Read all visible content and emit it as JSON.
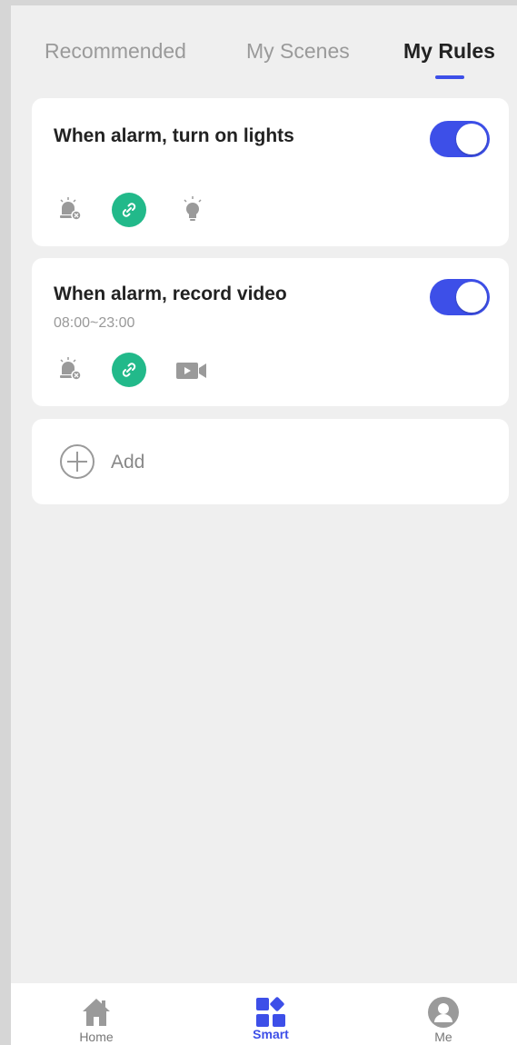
{
  "tabs": {
    "items": [
      {
        "label": "Recommended"
      },
      {
        "label": "My Scenes"
      },
      {
        "label": "My Rules"
      }
    ],
    "active_index": 2
  },
  "rules": [
    {
      "title": "When alarm, turn on lights",
      "schedule": "",
      "enabled": true,
      "icons": [
        "alarm-icon",
        "link-icon",
        "light-bulb-icon"
      ]
    },
    {
      "title": "When alarm, record video",
      "schedule": "08:00~23:00",
      "enabled": true,
      "icons": [
        "alarm-icon",
        "link-icon",
        "video-camera-icon"
      ]
    }
  ],
  "add": {
    "label": "Add"
  },
  "bottom_nav": {
    "items": [
      {
        "label": "Home",
        "icon": "home-icon"
      },
      {
        "label": "Smart",
        "icon": "smart-icon"
      },
      {
        "label": "Me",
        "icon": "profile-icon"
      }
    ],
    "active_index": 1
  },
  "colors": {
    "accent": "#3d4fe8",
    "link_green": "#22b98a",
    "background": "#efefef",
    "card": "#ffffff"
  }
}
